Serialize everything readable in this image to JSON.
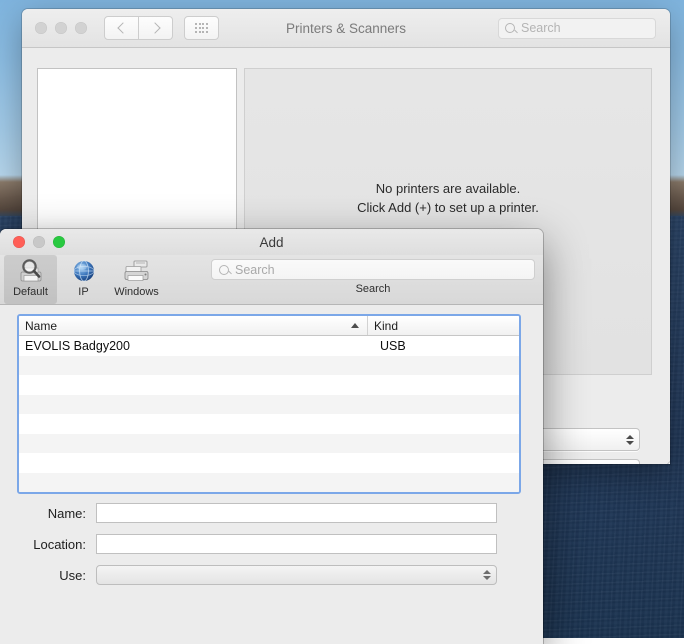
{
  "desktop": {
    "wallpaper_sky": "#8cbde3",
    "wallpaper_water": "#20395a"
  },
  "prefs_window": {
    "title": "Printers & Scanners",
    "traffic_lights": [
      {
        "name": "close",
        "color": "#d2d2d2"
      },
      {
        "name": "minimize",
        "color": "#d2d2d2"
      },
      {
        "name": "zoom",
        "color": "#d2d2d2"
      }
    ],
    "nav": {
      "back_icon": "chevron-left-icon",
      "forward_icon": "chevron-right-icon",
      "grid_icon": "show-all-grid-icon"
    },
    "search": {
      "placeholder": "Search",
      "value": "",
      "icon": "search-icon"
    },
    "empty_state": {
      "line1": "No printers are available.",
      "line2": "Click Add (+) to set up a printer."
    },
    "help_button_label": "?"
  },
  "add_dialog": {
    "title": "Add",
    "traffic_lights": [
      {
        "name": "close",
        "color": "#ff5f57"
      },
      {
        "name": "minimize",
        "color": "#c8c8c8"
      },
      {
        "name": "zoom",
        "color": "#28c940"
      }
    ],
    "toolbar": {
      "items": [
        {
          "label": "Default",
          "icon": "default-printer-search-icon",
          "selected": true
        },
        {
          "label": "IP",
          "icon": "globe-icon",
          "selected": false
        },
        {
          "label": "Windows",
          "icon": "windows-printer-icon",
          "selected": false
        }
      ],
      "search": {
        "placeholder": "Search",
        "value": "",
        "icon": "search-icon"
      },
      "search_label": "Search"
    },
    "results_table": {
      "columns": [
        {
          "label": "Name",
          "sorted": true,
          "sort_direction": "ascending"
        },
        {
          "label": "Kind",
          "sorted": false
        }
      ],
      "rows": [
        {
          "name": "EVOLIS Badgy200",
          "kind": "USB"
        }
      ],
      "empty_row_count": 8,
      "focus_ring_color": "#7ba7e8"
    },
    "form": {
      "name": {
        "label": "Name:",
        "value": ""
      },
      "location": {
        "label": "Location:",
        "value": ""
      },
      "use": {
        "label": "Use:",
        "value": ""
      }
    }
  }
}
